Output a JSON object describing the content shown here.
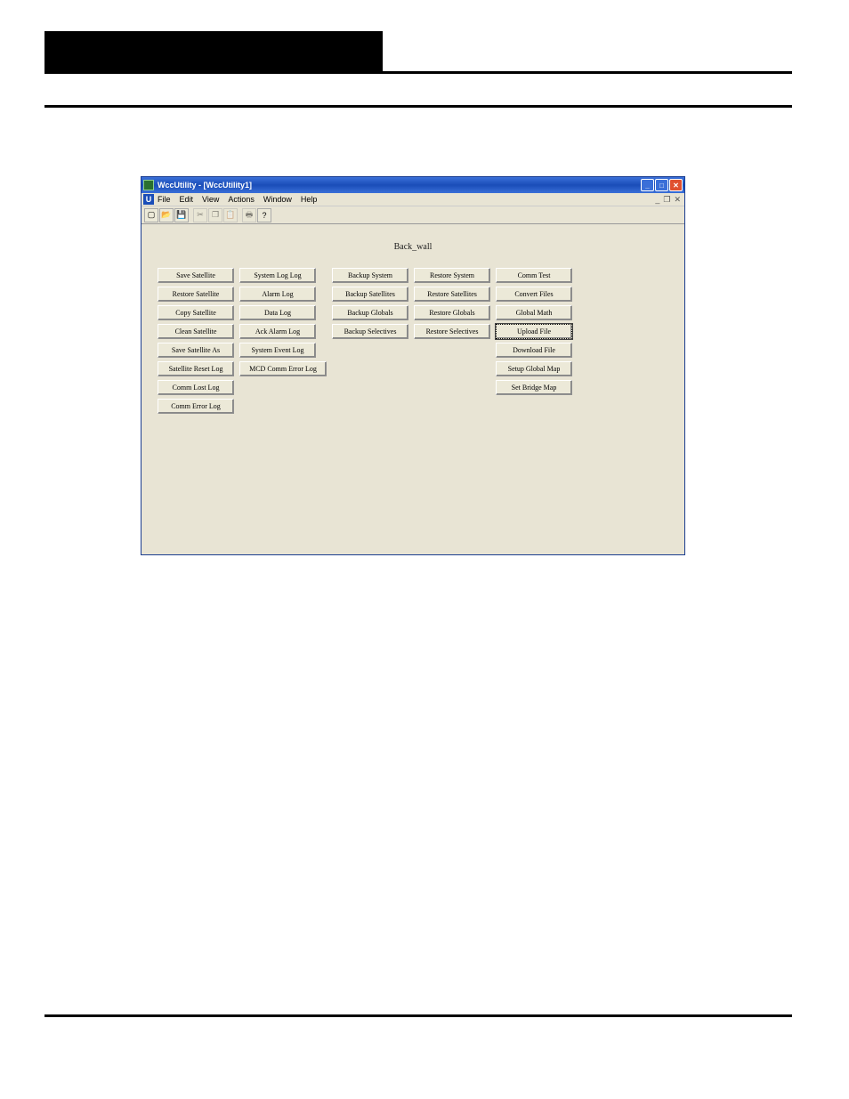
{
  "page": {
    "window_title": "WccUtility - [WccUtility1]",
    "content_label": "Back_wall"
  },
  "menus": {
    "file": "File",
    "edit": "Edit",
    "view": "View",
    "actions": "Actions",
    "window": "Window",
    "help": "Help"
  },
  "toolbar": {
    "new": "new",
    "open": "open",
    "save": "save",
    "cut": "cut",
    "copy": "copy",
    "paste": "paste",
    "print": "print",
    "help": "help"
  },
  "window_controls": {
    "minimize": "_",
    "maximize": "□",
    "close": "✕",
    "mdi_minimize": "_",
    "mdi_restore": "❐",
    "mdi_close": "✕"
  },
  "buttons": {
    "col1": {
      "b0": "Save Satellite",
      "b1": "Restore Satellite",
      "b2": "Copy Satellite",
      "b3": "Clean Satellite",
      "b4": "Save Satellite As",
      "b5": "Satellite Reset Log",
      "b6": "Comm Lost Log",
      "b7": "Comm Error Log"
    },
    "col2": {
      "b0": "System Log Log",
      "b1": "Alarm Log",
      "b2": "Data Log",
      "b3": "Ack Alarm Log",
      "b4": "System Event Log",
      "b5": "MCD Comm Error Log"
    },
    "col3": {
      "b0": "Backup System",
      "b1": "Backup Satellites",
      "b2": "Backup Globals",
      "b3": "Backup Selectives"
    },
    "col4": {
      "b0": "Restore System",
      "b1": "Restore Satellites",
      "b2": "Restore Globals",
      "b3": "Restore Selectives"
    },
    "col5": {
      "b0": "Comm Test",
      "b1": "Convert Files",
      "b2": "Global Math",
      "b3": "Upload File",
      "b4": "Download File",
      "b5": "Setup Global Map",
      "b6": "Set Bridge Map"
    }
  }
}
